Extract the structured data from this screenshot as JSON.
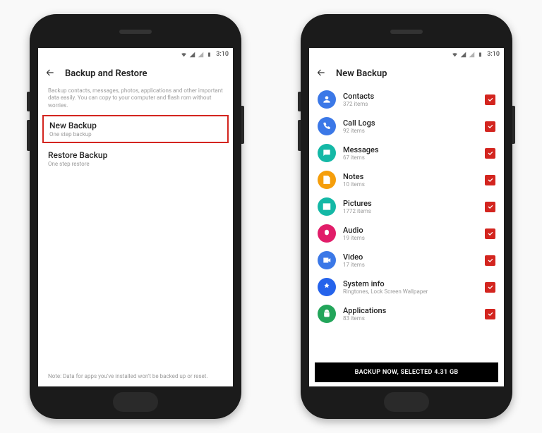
{
  "status": {
    "time": "3:10"
  },
  "left": {
    "title": "Backup and Restore",
    "description": "Backup contacts, messages, photos, applications and other important data easily. You can copy to your computer and flash rom without worries.",
    "options": {
      "new_backup": {
        "title": "New Backup",
        "subtitle": "One step backup"
      },
      "restore_backup": {
        "title": "Restore Backup",
        "subtitle": "One step restore"
      }
    },
    "footer_note": "Note: Data for apps you've installed won't be backed up or reset."
  },
  "right": {
    "title": "New Backup",
    "items": [
      {
        "label": "Contacts",
        "count": "372 items",
        "icon": "contacts",
        "color": "#3b78e7"
      },
      {
        "label": "Call Logs",
        "count": "92 items",
        "icon": "phone",
        "color": "#3b78e7"
      },
      {
        "label": "Messages",
        "count": "67 items",
        "icon": "message",
        "color": "#14b8a6"
      },
      {
        "label": "Notes",
        "count": "10 items",
        "icon": "notes",
        "color": "#f59e0b"
      },
      {
        "label": "Pictures",
        "count": "1772 items",
        "icon": "pictures",
        "color": "#14b8a6"
      },
      {
        "label": "Audio",
        "count": "19 items",
        "icon": "audio",
        "color": "#e11d69"
      },
      {
        "label": "Video",
        "count": "17 items",
        "icon": "video",
        "color": "#3b78e7"
      },
      {
        "label": "System info",
        "count": "Ringtones, Lock Screen Wallpaper",
        "icon": "system",
        "color": "#2563eb"
      },
      {
        "label": "Applications",
        "count": "83 items",
        "icon": "apps",
        "color": "#22a55a"
      }
    ],
    "action": "BACKUP NOW, SELECTED 4.31 GB"
  }
}
